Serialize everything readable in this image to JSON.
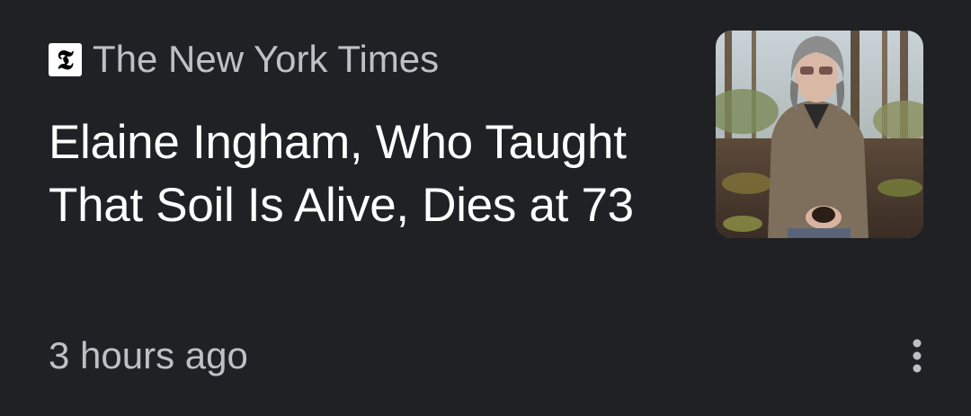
{
  "article": {
    "source_name": "The New York Times",
    "source_logo_icon": "nyt-logo-icon",
    "headline": "Elaine Ingham, Who Taught That Soil Is Alive, Dies at 73",
    "timestamp": "3 hours ago",
    "thumbnail_icon": "article-photo",
    "menu_icon": "more-vert-icon"
  },
  "colors": {
    "background": "#202124",
    "headline_text": "#ffffff",
    "secondary_text": "#bdc1c6",
    "icon": "#bdc1c6"
  }
}
